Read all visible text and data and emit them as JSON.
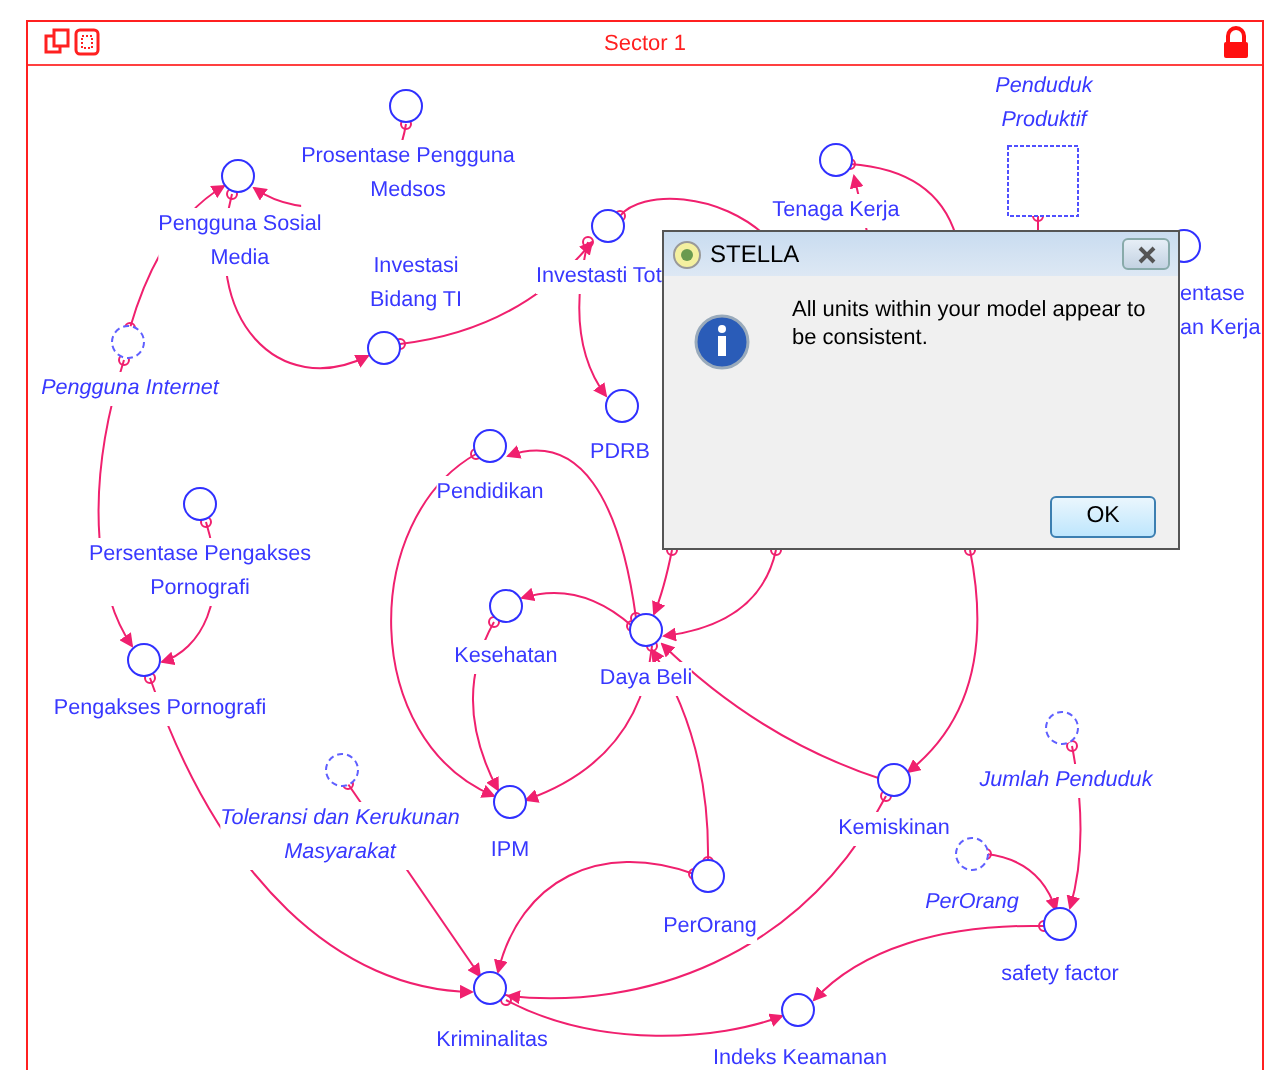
{
  "window": {
    "title": "Sector 1"
  },
  "diagram": {
    "nodes": [
      {
        "kind": "converter",
        "label": "Prosentase Pengguna\nMedsos"
      },
      {
        "kind": "converter",
        "label": "Pengguna Sosial\nMedia"
      },
      {
        "kind": "converter",
        "label": "Investasi\nBidang TI"
      },
      {
        "kind": "converter",
        "label": "Investasti Tot"
      },
      {
        "kind": "ghost",
        "label": "Pengguna Internet"
      },
      {
        "kind": "converter",
        "label": "PDRB"
      },
      {
        "kind": "converter",
        "label": "Pendidikan"
      },
      {
        "kind": "converter",
        "label": "Tenaga Kerja"
      },
      {
        "kind": "ghost-stock",
        "label": "Penduduk\nProduktif"
      },
      {
        "kind": "converter",
        "label": "entase\nan Kerja"
      },
      {
        "kind": "converter",
        "label": "Persentase Pengakses\nPornografi"
      },
      {
        "kind": "converter",
        "label": "Pengakses Pornografi"
      },
      {
        "kind": "converter",
        "label": "Kesehatan"
      },
      {
        "kind": "converter",
        "label": "Daya Beli"
      },
      {
        "kind": "converter",
        "label": "IPM"
      },
      {
        "kind": "ghost",
        "label": "Toleransi dan Kerukunan\nMasyarakat"
      },
      {
        "kind": "converter",
        "label": "Kemiskinan"
      },
      {
        "kind": "ghost",
        "label": "Jumlah Penduduk"
      },
      {
        "kind": "ghost",
        "label": "PerOrang"
      },
      {
        "kind": "converter",
        "label": "PerOrang"
      },
      {
        "kind": "converter",
        "label": "safety factor"
      },
      {
        "kind": "converter",
        "label": "Kriminalitas"
      },
      {
        "kind": "converter",
        "label": "Indeks Keamanan"
      }
    ]
  },
  "dialog": {
    "title": "STELLA",
    "message": "All units within your model appear to be consistent.",
    "buttons": [
      "OK"
    ]
  }
}
